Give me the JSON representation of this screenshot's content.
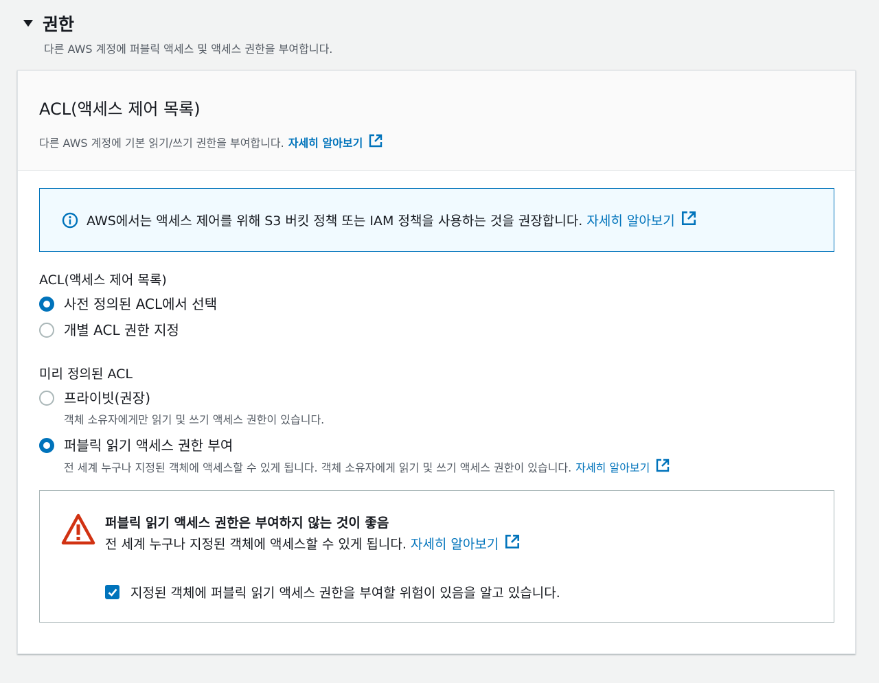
{
  "section": {
    "title": "권한",
    "description": "다른 AWS 계정에 퍼블릭 액세스 및 액세스 권한을 부여합니다."
  },
  "card": {
    "title": "ACL(액세스 제어 목록)",
    "description": "다른 AWS 계정에 기본 읽기/쓰기 권한을 부여합니다.",
    "learn_more": "자세히 알아보기"
  },
  "info": {
    "text": "AWS에서는 액세스 제어를 위해 S3 버킷 정책 또는 IAM 정책을 사용하는 것을 권장합니다.",
    "learn_more": "자세히 알아보기"
  },
  "acl": {
    "label": "ACL(액세스 제어 목록)",
    "options": [
      {
        "label": "사전 정의된 ACL에서 선택",
        "checked": true
      },
      {
        "label": "개별 ACL 권한 지정",
        "checked": false
      }
    ]
  },
  "predefined": {
    "label": "미리 정의된 ACL",
    "options": [
      {
        "label": "프라이빗(권장)",
        "description": "객체 소유자에게만 읽기 및 쓰기 액세스 권한이 있습니다.",
        "checked": false
      },
      {
        "label": "퍼블릭 읽기 액세스 권한 부여",
        "description": "전 세계 누구나 지정된 객체에 액세스할 수 있게 됩니다. 객체 소유자에게 읽기 및 쓰기 액세스 권한이 있습니다.",
        "learn_more": "자세히 알아보기",
        "checked": true
      }
    ]
  },
  "warning": {
    "title": "퍼블릭 읽기 액세스 권한은 부여하지 않는 것이 좋음",
    "description": "전 세계 누구나 지정된 객체에 액세스할 수 있게 됩니다.",
    "learn_more": "자세히 알아보기",
    "acknowledge": "지정된 객체에 퍼블릭 읽기 액세스 권한을 부여할 위험이 있음을 알고 있습니다.",
    "acknowledged": true
  },
  "colors": {
    "link": "#0073bb",
    "warning": "#d13212",
    "info_bg": "#f1faff"
  },
  "icons": {
    "section_toggle": "caret-down-icon",
    "external_link": "external-link-icon",
    "info": "info-circle-icon",
    "warning": "warning-triangle-icon",
    "check": "check-icon"
  }
}
